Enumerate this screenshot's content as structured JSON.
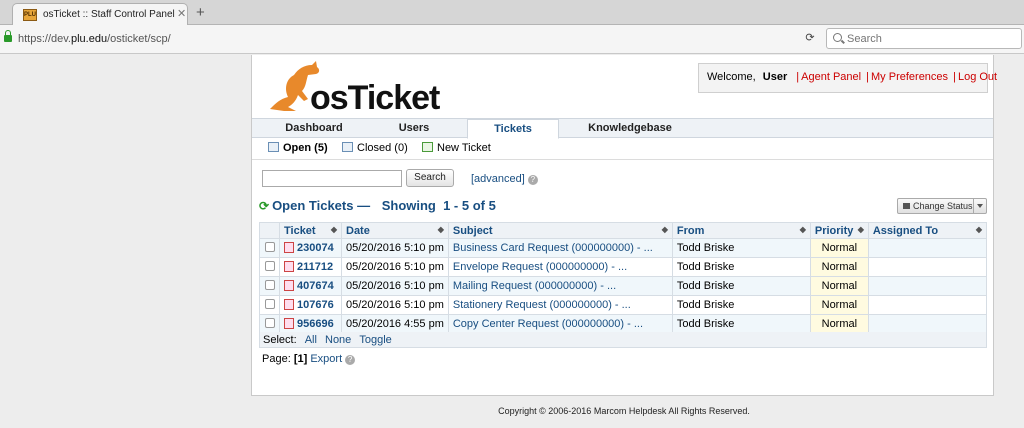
{
  "browser": {
    "tab_favicon": "PLU",
    "tab_title": "osTicket :: Staff Control Panel",
    "url_prefix": "https://dev.",
    "url_domain": "plu.edu",
    "url_suffix": "/osticket/scp/",
    "search_placeholder": "Search"
  },
  "header": {
    "logo_text": "osTicket",
    "welcome_label": "Welcome,",
    "user": "User",
    "links": [
      "Agent Panel",
      "My Preferences",
      "Log Out"
    ]
  },
  "nav": {
    "tabs": [
      "Dashboard",
      "Users",
      "Tickets",
      "Knowledgebase"
    ],
    "active": "Tickets"
  },
  "subnav": {
    "items": [
      "Open (5)",
      "Closed (0)",
      "New Ticket"
    ]
  },
  "search": {
    "value": "",
    "button": "Search",
    "advanced": "[advanced]"
  },
  "list": {
    "title": "Open Tickets —",
    "showing": "Showing  1 - 5 of 5",
    "change_status": "Change Status",
    "columns": [
      "Ticket",
      "Date",
      "Subject",
      "From",
      "Priority",
      "Assigned To"
    ],
    "rows": [
      {
        "ticket": "230074",
        "date": "05/20/2016 5:10 pm",
        "subject": "Business Card Request (000000000) - ...",
        "from": "Todd Briske",
        "priority": "Normal",
        "assigned": ""
      },
      {
        "ticket": "211712",
        "date": "05/20/2016 5:10 pm",
        "subject": "Envelope Request (000000000) - ...",
        "from": "Todd Briske",
        "priority": "Normal",
        "assigned": ""
      },
      {
        "ticket": "407674",
        "date": "05/20/2016 5:10 pm",
        "subject": "Mailing Request (000000000) - ...",
        "from": "Todd Briske",
        "priority": "Normal",
        "assigned": ""
      },
      {
        "ticket": "107676",
        "date": "05/20/2016 5:10 pm",
        "subject": "Stationery Request (000000000) - ...",
        "from": "Todd Briske",
        "priority": "Normal",
        "assigned": ""
      },
      {
        "ticket": "956696",
        "date": "05/20/2016 4:55 pm",
        "subject": "Copy Center Request (000000000) - ...",
        "from": "Todd Briske",
        "priority": "Normal",
        "assigned": ""
      }
    ],
    "select_label": "Select:",
    "select_options": [
      "All",
      "None",
      "Toggle"
    ],
    "page_label": "Page:",
    "page_current": "[1]",
    "export": "Export"
  },
  "footer": {
    "copyright": "Copyright © 2006-2016 Marcom Helpdesk All Rights Reserved."
  },
  "colors": {
    "accent": "#184e81",
    "link_red": "#cc0000",
    "logo_orange": "#e8892b"
  }
}
